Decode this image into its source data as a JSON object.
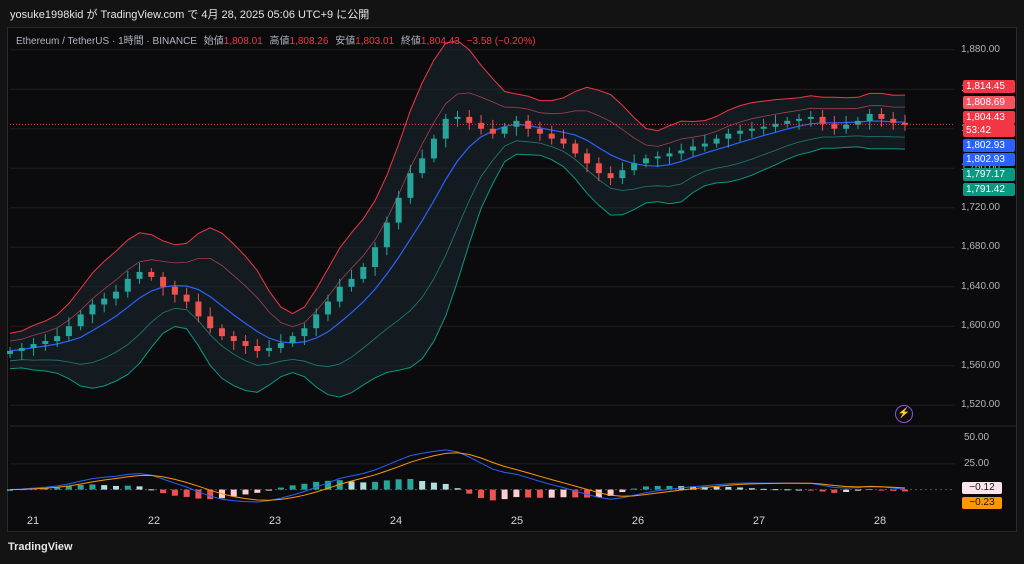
{
  "header": {
    "publish_line": "yosuke1998kid が TradingView.com で 4月 28, 2025 05:06 UTC+9 に公開"
  },
  "legend": {
    "symbol": "Ethereum / TetherUS · 1時間 · BINANCE",
    "open_label": "始値",
    "open": "1,808.01",
    "high_label": "高値",
    "high": "1,808.26",
    "low_label": "安値",
    "low": "1,803.01",
    "close_label": "終値",
    "close": "1,804.43",
    "change": "−3.58 (−0.20%)"
  },
  "price_axis": [
    "1,880.00",
    "1,840.00",
    "1,800.00",
    "1,760.00",
    "1,720.00",
    "1,680.00",
    "1,640.00",
    "1,600.00",
    "1,560.00",
    "1,520.00"
  ],
  "macd_axis": [
    "50.00",
    "25.00",
    "0.00"
  ],
  "x_axis": [
    "21",
    "22",
    "23",
    "24",
    "25",
    "26",
    "27",
    "28"
  ],
  "price_tags": [
    {
      "text": "1,814.45",
      "color": "#f23645"
    },
    {
      "text": "1,808.69",
      "color": "#f7525f"
    },
    {
      "text": "1,804.43",
      "color": "#f23645"
    },
    {
      "text": "53:42",
      "color": "#f23645"
    },
    {
      "text": "1,802.93",
      "color": "#2962ff"
    },
    {
      "text": "1,802.93",
      "color": "#2962ff"
    },
    {
      "text": "1,797.17",
      "color": "#089981"
    },
    {
      "text": "1,791.42",
      "color": "#089981"
    }
  ],
  "macd_tags": [
    {
      "text": "−0.12",
      "color": "#fce4ec",
      "fg": "#131313"
    },
    {
      "text": "−0.23",
      "color": "#ff9800",
      "fg": "#131313"
    }
  ],
  "brand": "TradingView",
  "colors": {
    "up": "#26a69a",
    "down": "#ef5350",
    "basis": "#2962ff",
    "bb_upper": "#f23645",
    "bb_lower": "#089981",
    "macd": "#2962ff",
    "signal": "#ff9800"
  },
  "chart_data": {
    "type": "candlestick",
    "interval": "1h",
    "x_labels": [
      "21",
      "22",
      "23",
      "24",
      "25",
      "26",
      "27",
      "28"
    ],
    "close_series": [
      1575,
      1578,
      1582,
      1585,
      1590,
      1600,
      1612,
      1622,
      1628,
      1635,
      1648,
      1655,
      1650,
      1640,
      1632,
      1625,
      1610,
      1598,
      1590,
      1585,
      1580,
      1575,
      1578,
      1583,
      1590,
      1598,
      1612,
      1625,
      1640,
      1648,
      1660,
      1680,
      1705,
      1730,
      1755,
      1770,
      1790,
      1810,
      1812,
      1806,
      1800,
      1795,
      1802,
      1808,
      1800,
      1795,
      1790,
      1785,
      1775,
      1765,
      1755,
      1750,
      1758,
      1765,
      1770,
      1772,
      1775,
      1778,
      1782,
      1785,
      1790,
      1795,
      1798,
      1800,
      1802,
      1805,
      1808,
      1810,
      1812,
      1805,
      1800,
      1804,
      1808,
      1815,
      1810,
      1806,
      1804
    ],
    "ylim": [
      1500,
      1900
    ],
    "macd_ylim": [
      -15,
      60
    ]
  }
}
